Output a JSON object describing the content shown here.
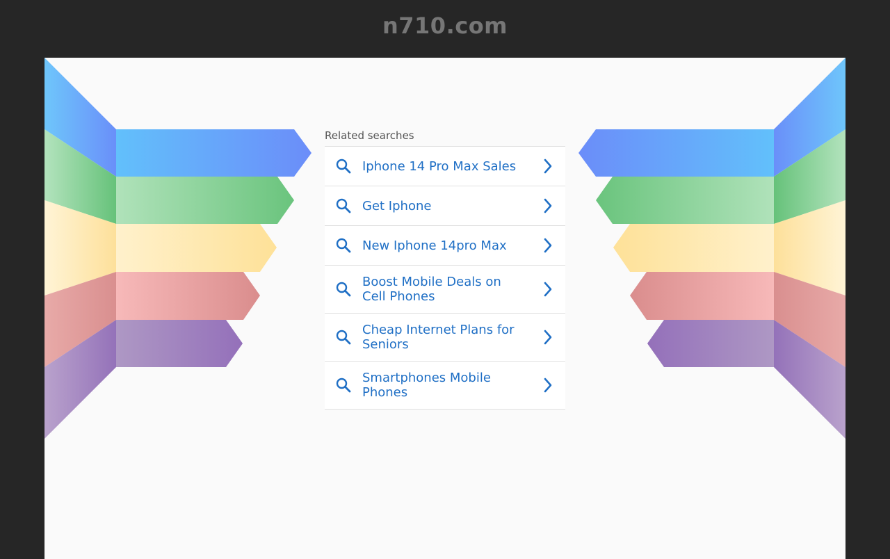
{
  "header": {
    "domain": "n710.com"
  },
  "related": {
    "heading": "Related searches",
    "items": [
      {
        "label": "Iphone 14 Pro Max Sales"
      },
      {
        "label": "Get Iphone"
      },
      {
        "label": "New Iphone 14pro Max"
      },
      {
        "label": "Boost Mobile Deals on Cell Phones"
      },
      {
        "label": "Cheap Internet Plans for Seniors"
      },
      {
        "label": "Smartphones Mobile Phones"
      }
    ]
  },
  "colors": {
    "link": "#1f6fc5",
    "blue": "#64b5f6",
    "green": "#81c784",
    "yellow": "#ffe082",
    "red": "#e57373",
    "purple": "#9575cd"
  },
  "icons": {
    "search": "search-icon",
    "chevron": "chevron-right-icon"
  }
}
